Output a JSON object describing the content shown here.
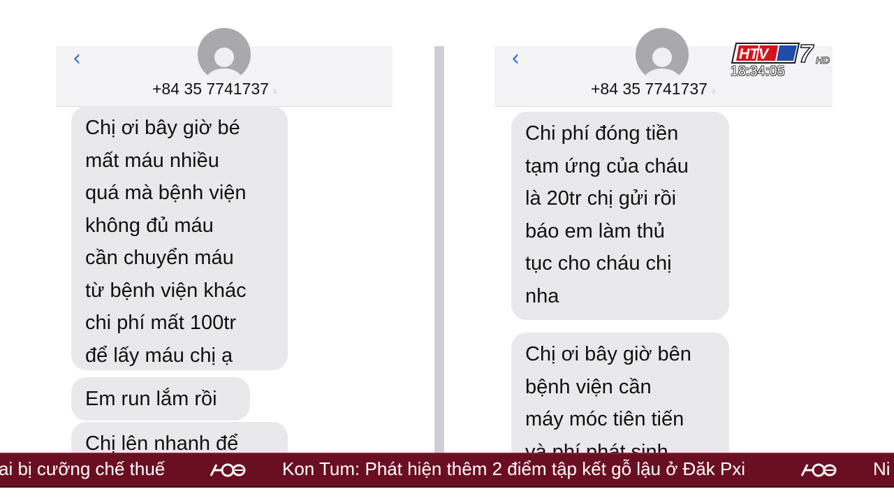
{
  "left_chat": {
    "phone": "+84 35 7741737",
    "bubbles": [
      {
        "lines": [
          "Chị ơi bây giờ bé",
          "mất máu nhiều",
          "quá mà bệnh viện",
          "không đủ máu",
          "cần chuyển máu",
          "từ bệnh viện khác",
          "chi phí mất 100tr",
          "để lấy máu chị ạ"
        ]
      },
      {
        "lines": [
          "Em run lắm rồi"
        ]
      },
      {
        "lines": [
          "Chị lên nhanh để"
        ]
      }
    ]
  },
  "right_chat": {
    "phone": "+84 35 7741737",
    "bubbles": [
      {
        "lines": [
          "Chi phí đóng tiền",
          "tạm ứng của cháu",
          "là 20tr chị gửi rồi",
          "báo em làm thủ",
          "tục cho cháu chị",
          "nha"
        ]
      },
      {
        "lines": [
          "Chị ơi bây giờ bên",
          "bệnh viện cần",
          "máy móc tiên tiến",
          "và phí phát sinh"
        ]
      }
    ]
  },
  "channel": {
    "brand": "HTV",
    "number": "7",
    "quality": "HD",
    "time": "18:34:05"
  },
  "ticker": {
    "items": [
      "ai bị cưỡng chế thuế",
      "Kon Tum: Phát hiện thêm 2 điểm tập kết gỗ lậu ở Đăk Pxi",
      "Ni"
    ]
  },
  "colors": {
    "bubble": "#e9e9eb",
    "ios_blue": "#2f6fd6",
    "ticker_bg": "#6a0f22"
  }
}
